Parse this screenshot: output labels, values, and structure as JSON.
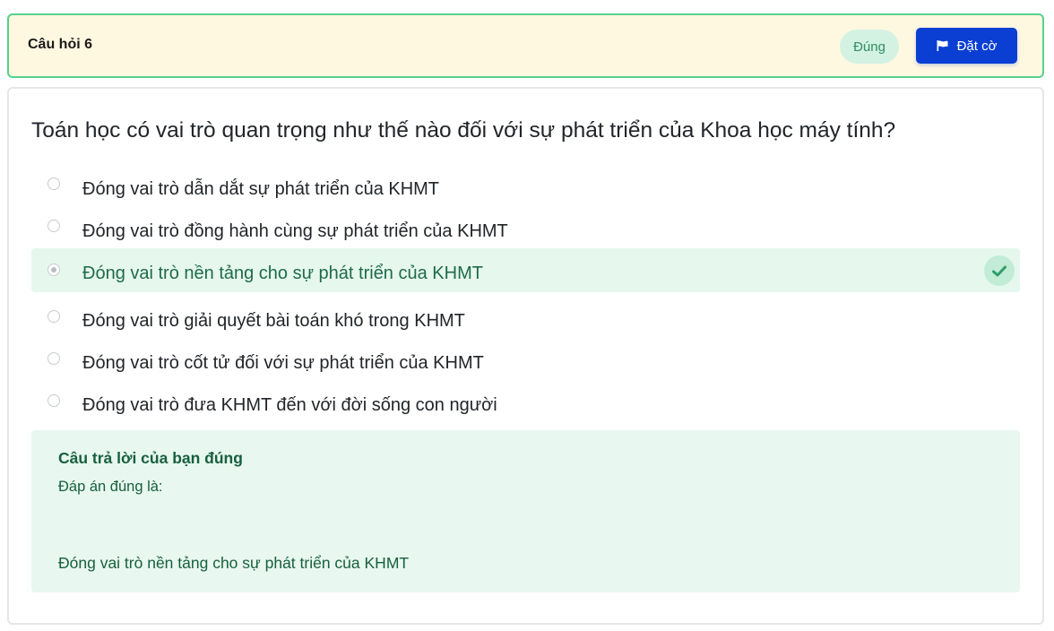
{
  "header": {
    "title": "Câu hỏi 6",
    "status": "Đúng",
    "flag_label": "Đặt cờ"
  },
  "question": {
    "text": "Toán học có vai trò quan trọng như thế nào đối với sự phát triển của Khoa học máy tính?",
    "options": [
      {
        "label": "Đóng vai trò dẫn dắt sự phát triển của KHMT",
        "selected": false
      },
      {
        "label": "Đóng vai trò đồng hành cùng sự phát triển của KHMT",
        "selected": false
      },
      {
        "label": "Đóng vai trò nền tảng cho sự phát triển của KHMT",
        "selected": true,
        "correct": true
      },
      {
        "label": "Đóng vai trò giải quyết bài toán khó trong KHMT",
        "selected": false
      },
      {
        "label": "Đóng vai trò cốt tử đối với sự phát triển của KHMT",
        "selected": false
      },
      {
        "label": "Đóng vai trò đưa KHMT đến với đời sống con người",
        "selected": false
      }
    ]
  },
  "feedback": {
    "title": "Câu trả lời của bạn đúng",
    "answer_label": "Đáp án đúng là:",
    "answer": "Đóng vai trò nền tảng cho sự phát triển của KHMT"
  },
  "colors": {
    "header_bg": "#fff8e1",
    "header_border": "#57d08f",
    "flag_button": "#0b3fd3",
    "correct_bg": "#e6f7ee",
    "correct_text": "#1e6b4a"
  },
  "icons": {
    "flag": "flag-icon",
    "check": "check-icon",
    "radio": "radio-button"
  }
}
